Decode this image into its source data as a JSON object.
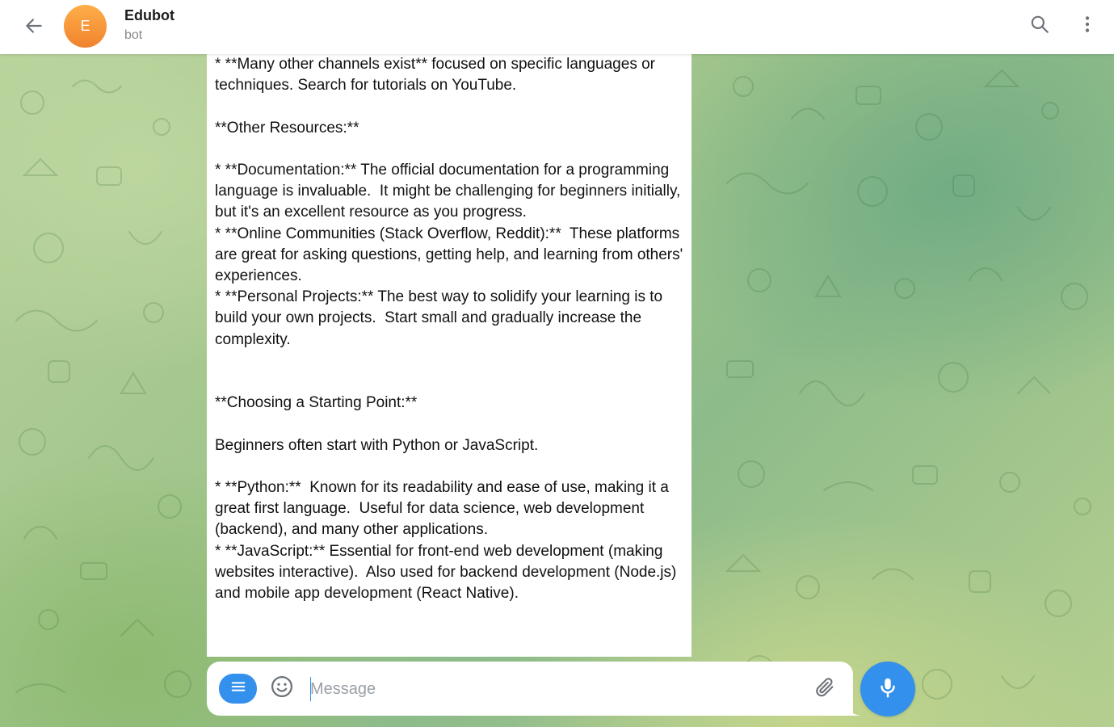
{
  "header": {
    "back_icon": "arrow-left-icon",
    "avatar_letter": "E",
    "title": "Edubot",
    "status": "bot",
    "search_icon": "search-icon",
    "menu_icon": "more-vertical-icon"
  },
  "message": {
    "text": "* **Many other channels exist** focused on specific languages or techniques. Search for tutorials on YouTube.\n\n**Other Resources:**\n\n* **Documentation:** The official documentation for a programming language is invaluable.  It might be challenging for beginners initially, but it's an excellent resource as you progress.\n* **Online Communities (Stack Overflow, Reddit):**  These platforms are great for asking questions, getting help, and learning from others' experiences.\n* **Personal Projects:** The best way to solidify your learning is to build your own projects.  Start small and gradually increase the complexity.\n\n\n**Choosing a Starting Point:**\n\nBeginners often start with Python or JavaScript.\n\n* **Python:**  Known for its readability and ease of use, making it a great first language.  Useful for data science, web development (backend), and many other applications.\n* **JavaScript:** Essential for front-end web development (making websites interactive).  Also used for backend development (Node.js) and mobile app development (React Native)."
  },
  "composer": {
    "placeholder": "Message",
    "value": "",
    "bot_menu_icon": "menu-lines-icon",
    "emoji_icon": "smile-icon",
    "attach_icon": "paperclip-icon",
    "mic_icon": "microphone-icon"
  },
  "colors": {
    "accent": "#3390ec",
    "avatar": "#f0832e",
    "background": "#a9c98f"
  }
}
